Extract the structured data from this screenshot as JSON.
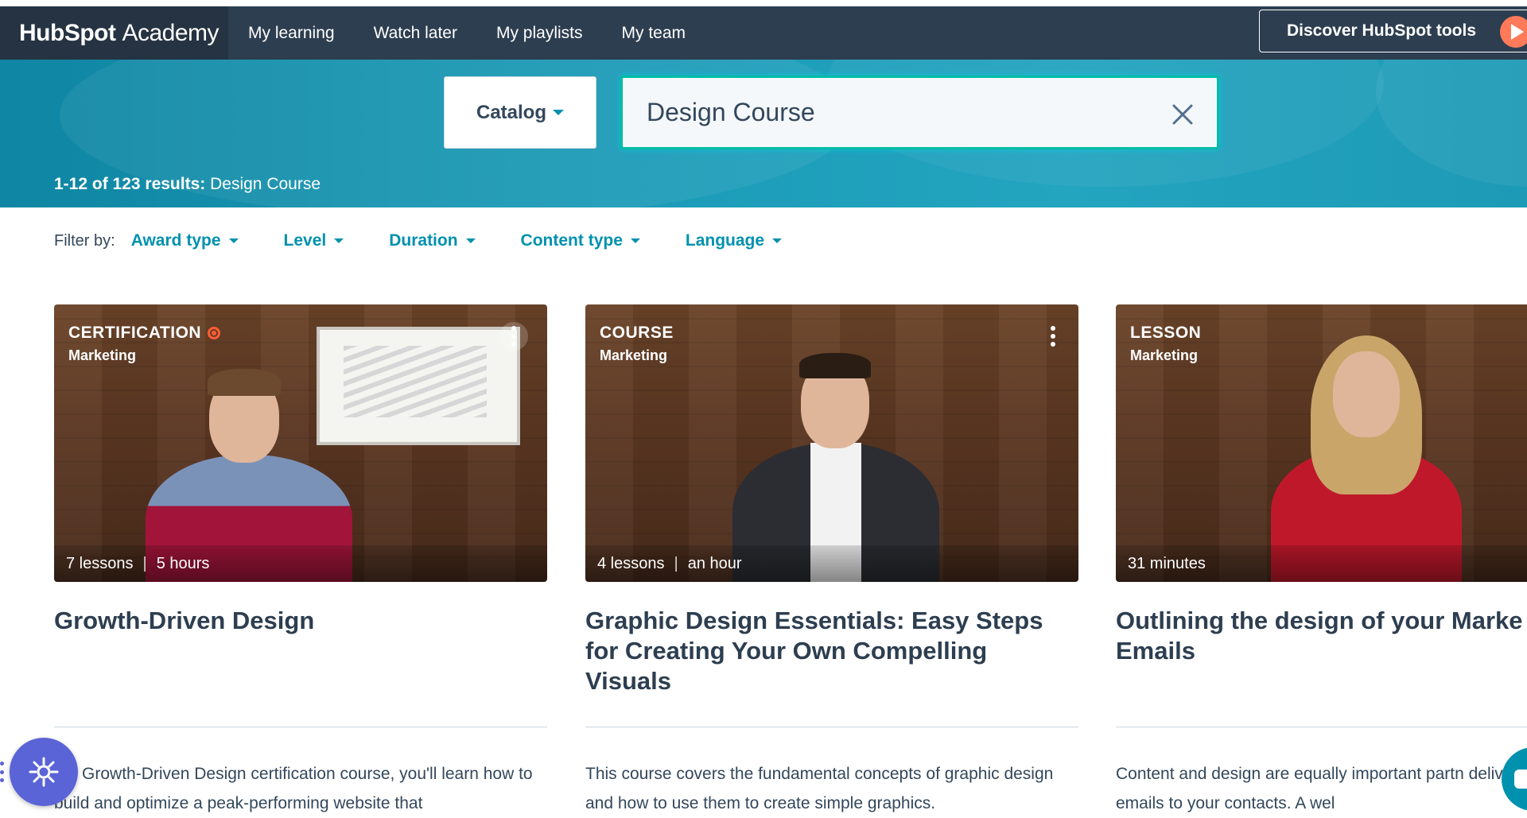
{
  "nav": {
    "brand_logo": "HubSpot",
    "brand_suffix": "Academy",
    "items": [
      {
        "label": "My learning"
      },
      {
        "label": "Watch later"
      },
      {
        "label": "My playlists"
      },
      {
        "label": "My team"
      }
    ],
    "cta_label": "Discover HubSpot tools"
  },
  "search": {
    "catalog_label": "Catalog",
    "query": "Design Course",
    "results_count": "1-12 of 123 results:",
    "results_query": "Design Course"
  },
  "filters": {
    "label": "Filter by:",
    "items": [
      {
        "label": "Award type"
      },
      {
        "label": "Level"
      },
      {
        "label": "Duration"
      },
      {
        "label": "Content type"
      },
      {
        "label": "Language"
      }
    ]
  },
  "cards": [
    {
      "type": "CERTIFICATION",
      "category": "Marketing",
      "lessons": "7 lessons",
      "duration": "5 hours",
      "title": "Growth-Driven Design",
      "description": "the Growth-Driven Design certification course, you'll learn how to build and optimize a peak-performing website that"
    },
    {
      "type": "COURSE",
      "category": "Marketing",
      "lessons": "4 lessons",
      "duration": "an hour",
      "title": "Graphic Design Essentials: Easy Steps for Creating Your Own Compelling Visuals",
      "description": "This course covers the fundamental concepts of graphic design and how to use them to create simple graphics."
    },
    {
      "type": "LESSON",
      "category": "Marketing",
      "duration": "31 minutes",
      "title": "Outlining the design of your Marke Emails",
      "description": "Content and design are equally important partn delivering valuable emails to your contacts. A wel"
    }
  ],
  "colors": {
    "nav_bg": "#2d3e50",
    "accent_teal": "#0091ae",
    "orange": "#ff7a59",
    "fab_purple": "#5a64d6"
  }
}
